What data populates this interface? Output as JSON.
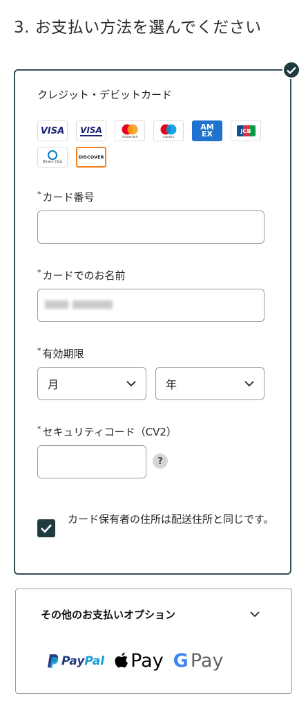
{
  "section_title": "3. お支払い方法を選んでください",
  "card_panel": {
    "method_label": "クレジット・デビットカード",
    "logos": [
      {
        "name": "VISA",
        "text": "VISA"
      },
      {
        "name": "VISA Electron",
        "text": "VISA"
      },
      {
        "name": "Mastercard",
        "text": "mastercard"
      },
      {
        "name": "Maestro",
        "text": "maestro"
      },
      {
        "name": "American Express",
        "text": "AM EX"
      },
      {
        "name": "JCB",
        "text": "JCB"
      },
      {
        "name": "Diners Club",
        "text": "Diners Club"
      },
      {
        "name": "Discover",
        "text": "DISCOVER"
      }
    ],
    "required_mark": "*",
    "card_number_label": "カード番号",
    "card_name_label": "カードでのお名前",
    "expiry_label": "有効期限",
    "month_value": "月",
    "year_value": "年",
    "cvv_label": "セキュリティコード（CV2）",
    "help_glyph": "?",
    "same_address_text": "カード保有者の住所は配送住所と同じです。",
    "same_address_checked": true
  },
  "other_options": {
    "title": "その他のお支払いオプション",
    "paypal": {
      "pay": "Pay",
      "pal": "Pal"
    },
    "apple_pay": "Pay",
    "google_pay": {
      "g": "G",
      "pay": "Pay"
    }
  },
  "colors": {
    "accent": "#1f3b40",
    "border": "#2f4f55",
    "paypal_dark": "#253b80",
    "paypal_light": "#179bd7"
  }
}
